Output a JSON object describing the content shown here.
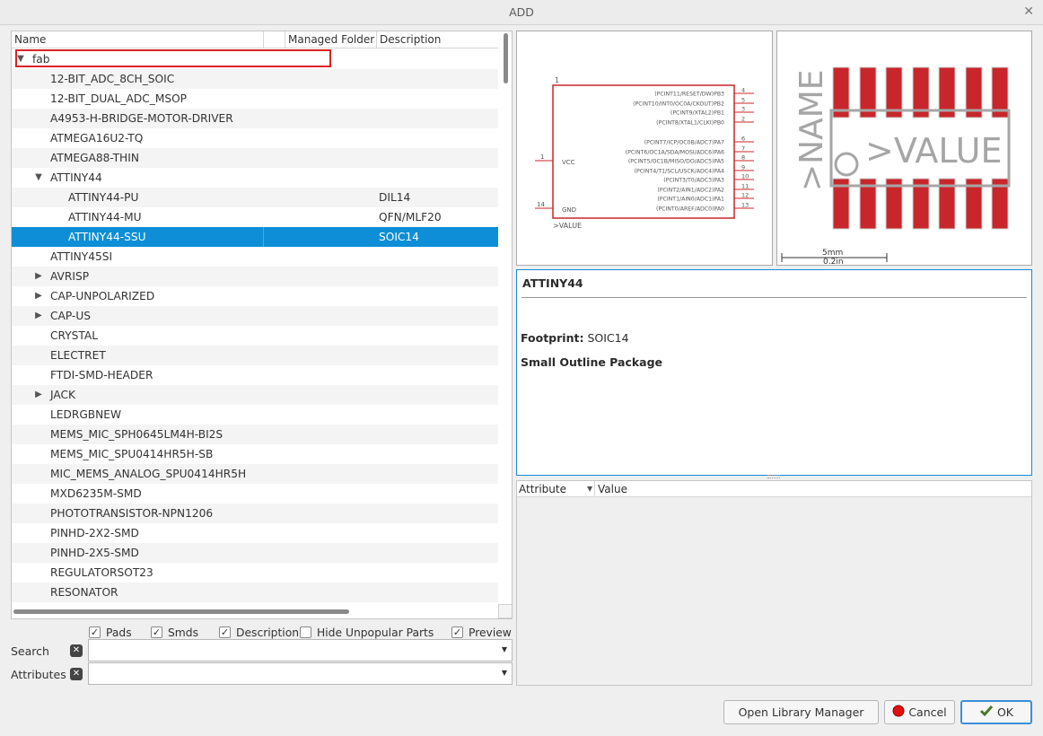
{
  "window": {
    "title": "ADD"
  },
  "tree": {
    "columns": {
      "name": "Name",
      "managed": "Managed Folder",
      "description": "Description"
    },
    "rows": [
      {
        "level": 0,
        "toggle": "down",
        "name": "fab",
        "desc": ""
      },
      {
        "level": 1,
        "toggle": "",
        "name": "12-BIT_ADC_8CH_SOIC",
        "desc": ""
      },
      {
        "level": 1,
        "toggle": "",
        "name": "12-BIT_DUAL_ADC_MSOP",
        "desc": ""
      },
      {
        "level": 1,
        "toggle": "",
        "name": "A4953-H-BRIDGE-MOTOR-DRIVER",
        "desc": ""
      },
      {
        "level": 1,
        "toggle": "",
        "name": "ATMEGA16U2-TQ",
        "desc": ""
      },
      {
        "level": 1,
        "toggle": "",
        "name": "ATMEGA88-THIN",
        "desc": ""
      },
      {
        "level": 1,
        "toggle": "down",
        "name": "ATTINY44",
        "desc": ""
      },
      {
        "level": 2,
        "toggle": "",
        "name": "ATTINY44-PU",
        "desc": "DIL14"
      },
      {
        "level": 2,
        "toggle": "",
        "name": "ATTINY44-MU",
        "desc": "QFN/MLF20"
      },
      {
        "level": 2,
        "toggle": "",
        "name": "ATTINY44-SSU",
        "desc": "SOIC14",
        "selected": true
      },
      {
        "level": 1,
        "toggle": "",
        "name": "ATTINY45SI",
        "desc": ""
      },
      {
        "level": 1,
        "toggle": "right",
        "name": "AVRISP",
        "desc": ""
      },
      {
        "level": 1,
        "toggle": "right",
        "name": "CAP-UNPOLARIZED",
        "desc": ""
      },
      {
        "level": 1,
        "toggle": "right",
        "name": "CAP-US",
        "desc": ""
      },
      {
        "level": 1,
        "toggle": "",
        "name": "CRYSTAL",
        "desc": ""
      },
      {
        "level": 1,
        "toggle": "",
        "name": "ELECTRET",
        "desc": ""
      },
      {
        "level": 1,
        "toggle": "",
        "name": "FTDI-SMD-HEADER",
        "desc": ""
      },
      {
        "level": 1,
        "toggle": "right",
        "name": "JACK",
        "desc": ""
      },
      {
        "level": 1,
        "toggle": "",
        "name": "LEDRGBNEW",
        "desc": ""
      },
      {
        "level": 1,
        "toggle": "",
        "name": "MEMS_MIC_SPH0645LM4H-BI2S",
        "desc": ""
      },
      {
        "level": 1,
        "toggle": "",
        "name": "MEMS_MIC_SPU0414HR5H-SB",
        "desc": ""
      },
      {
        "level": 1,
        "toggle": "",
        "name": "MIC_MEMS_ANALOG_SPU0414HR5H",
        "desc": ""
      },
      {
        "level": 1,
        "toggle": "",
        "name": "MXD6235M-SMD",
        "desc": ""
      },
      {
        "level": 1,
        "toggle": "",
        "name": "PHOTOTRANSISTOR-NPN1206",
        "desc": ""
      },
      {
        "level": 1,
        "toggle": "",
        "name": "PINHD-2X2-SMD",
        "desc": ""
      },
      {
        "level": 1,
        "toggle": "",
        "name": "PINHD-2X5-SMD",
        "desc": ""
      },
      {
        "level": 1,
        "toggle": "",
        "name": "REGULATORSOT23",
        "desc": ""
      },
      {
        "level": 1,
        "toggle": "",
        "name": "RESONATOR",
        "desc": ""
      }
    ]
  },
  "symbol": {
    "pin_top": "1",
    "vcc_label": "VCC",
    "gnd_label": "GND",
    "vcc_pin": "1",
    "gnd_pin": "14",
    "value_label": ">VALUE",
    "right_pins": [
      {
        "label": "(PCINT11/RESET/DW)PB3",
        "num": "4"
      },
      {
        "label": "(PCINT10/INT0/OC0A/CKOUT)PB2",
        "num": "5"
      },
      {
        "label": "(PCINT9/XTAL2)PB1",
        "num": "3"
      },
      {
        "label": "(PCINT8/XTAL1/CLKI)PB0",
        "num": "2"
      },
      {
        "label": "(PCINT7/ICP/OC0B/ADC7)PA7",
        "num": "6"
      },
      {
        "label": "(PCINT6/OC1A/SDA/MOSI/ADC6)PA6",
        "num": "7"
      },
      {
        "label": "(PCINT5/OC1B/MISO/DO/ADC5)PA5",
        "num": "8"
      },
      {
        "label": "(PCINT4/T1/SCL/USCK/ADC4)PA4",
        "num": "9"
      },
      {
        "label": "(PCINT3/T0/ADC3)PA3",
        "num": "10"
      },
      {
        "label": "(PCINT2/AIN1/ADC2)PA2",
        "num": "11"
      },
      {
        "label": "(PCINT1/AIN0/ADC1)PA1",
        "num": "12"
      },
      {
        "label": "(PCINT0/AREF/ADC0)PA0",
        "num": "13"
      }
    ]
  },
  "package": {
    "name_label": ">NAME",
    "value_label": ">VALUE",
    "scale_mm": "5mm",
    "scale_in": "0.2in"
  },
  "description": {
    "title": "ATTINY44",
    "footprint_label": "Footprint:",
    "footprint_value": "SOIC14",
    "package_text": "Small Outline Package"
  },
  "attributes": {
    "col_attribute": "Attribute",
    "col_value": "Value"
  },
  "filters": {
    "pads": {
      "label": "Pads",
      "checked": true
    },
    "smds": {
      "label": "Smds",
      "checked": true
    },
    "description": {
      "label": "Description",
      "checked": true
    },
    "hide_unpopular": {
      "label": "Hide Unpopular Parts",
      "checked": false
    },
    "preview": {
      "label": "Preview",
      "checked": true
    }
  },
  "search": {
    "label": "Search",
    "value": "",
    "placeholder": ""
  },
  "attrs_filter": {
    "label": "Attributes",
    "value": "",
    "placeholder": ""
  },
  "buttons": {
    "library_manager": "Open Library Manager",
    "cancel": "Cancel",
    "ok": "OK"
  },
  "colors": {
    "selection": "#0d8ed6",
    "highlight_box": "#dd2222",
    "symbol_red": "#c8262a",
    "pad_red": "#c8262a"
  }
}
